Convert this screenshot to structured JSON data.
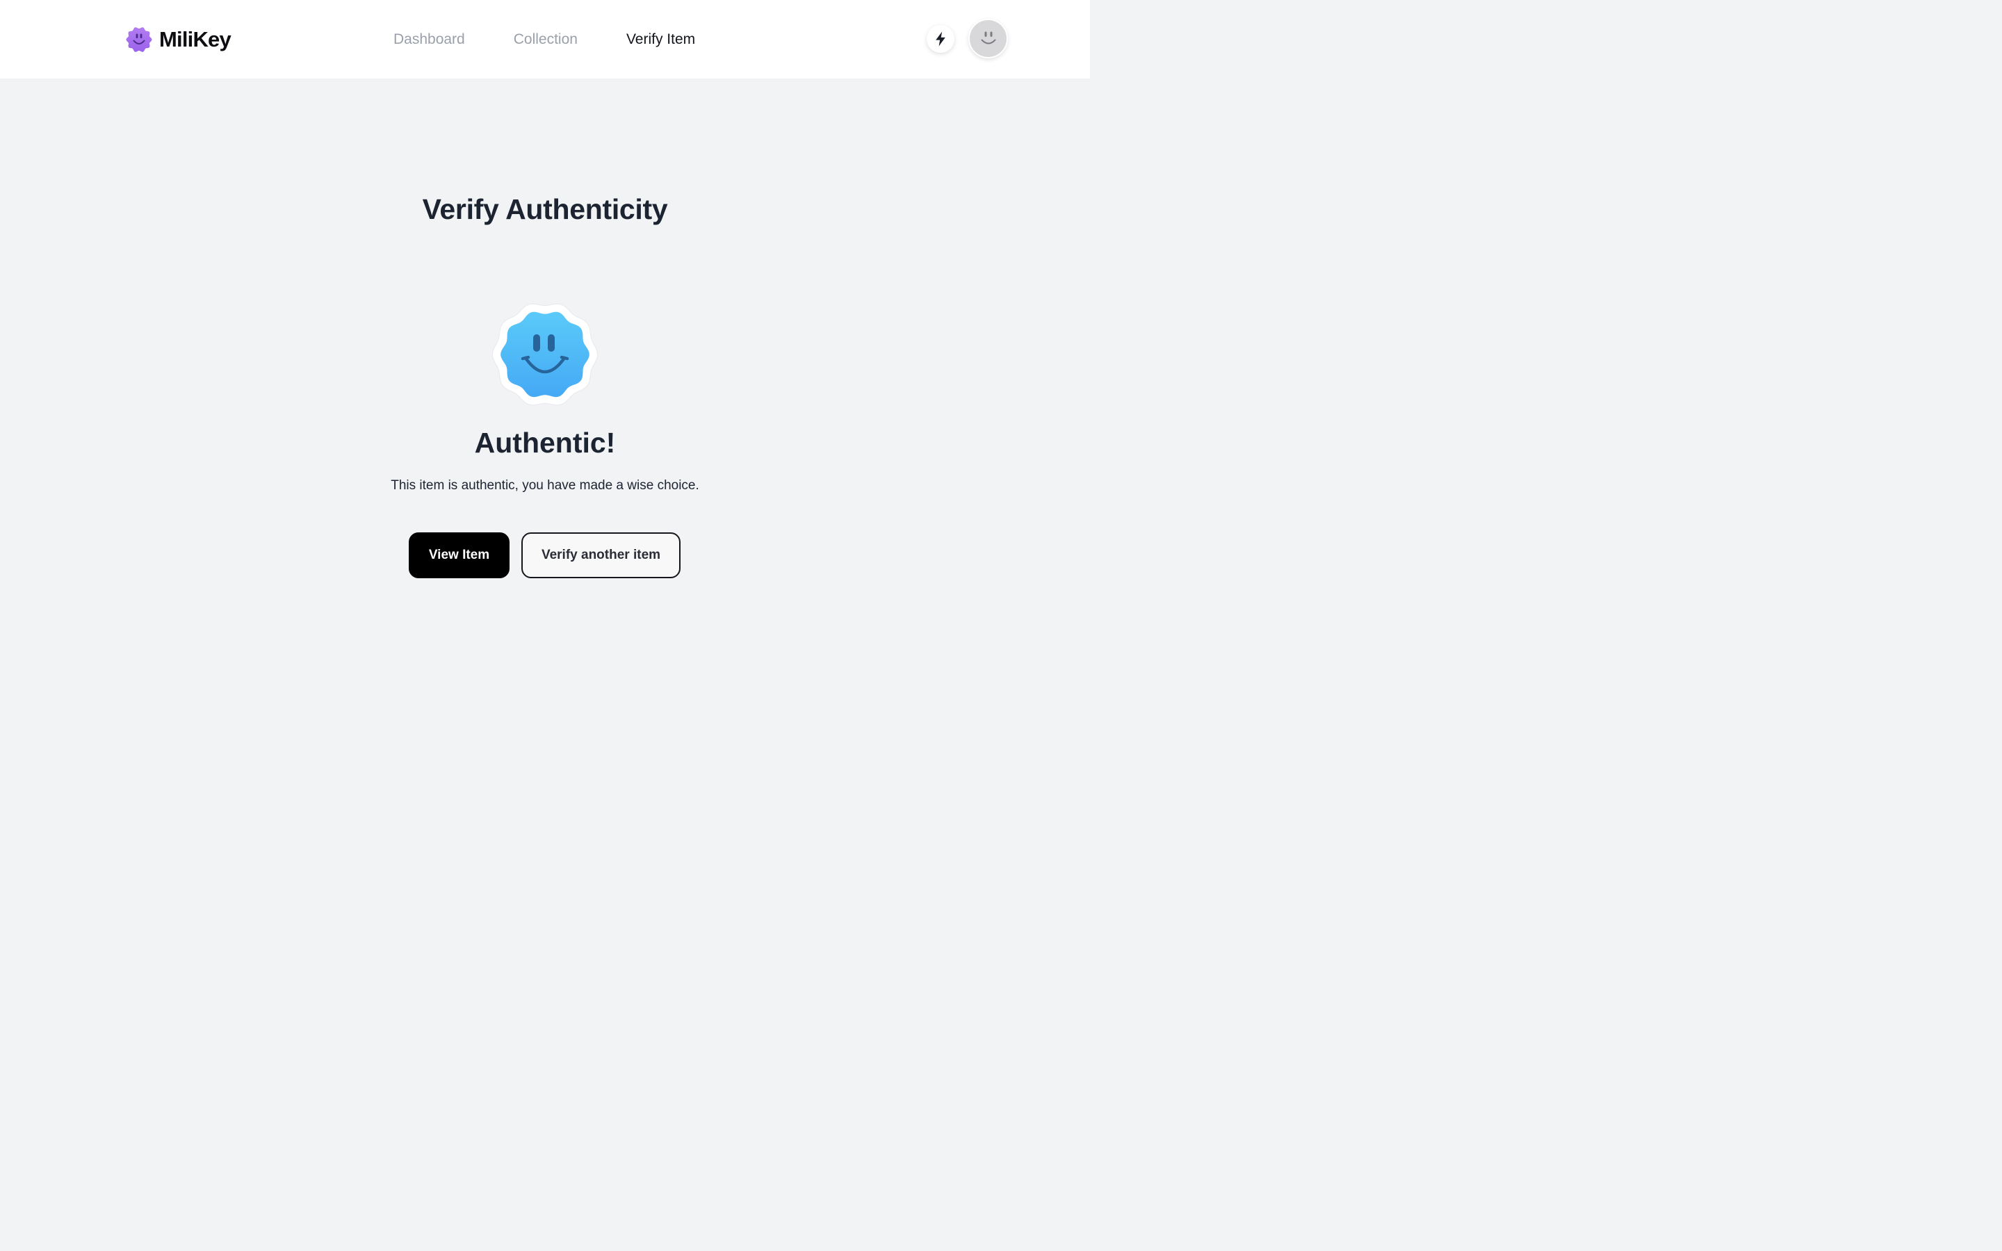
{
  "brand": {
    "name": "MiliKey",
    "logo_icon": "smiley-flower-icon",
    "logo_color": "#a66df0"
  },
  "nav": {
    "items": [
      {
        "label": "Dashboard",
        "active": false
      },
      {
        "label": "Collection",
        "active": false
      },
      {
        "label": "Verify Item",
        "active": true
      }
    ]
  },
  "header_actions": {
    "quick_action_icon": "lightning-bolt-icon",
    "avatar_icon": "smiley-avatar-icon"
  },
  "main": {
    "title": "Verify Authenticity",
    "result": {
      "status_icon": "authentic-smiley-badge-icon",
      "badge_color": "#4fb3f6",
      "heading": "Authentic!",
      "message": "This item is authentic, you have made a wise choice."
    },
    "actions": {
      "primary_label": "View Item",
      "secondary_label": "Verify another item"
    }
  }
}
